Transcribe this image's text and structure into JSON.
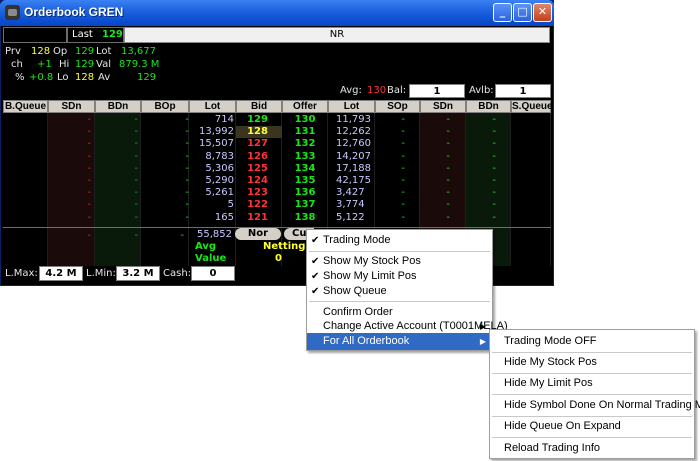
{
  "window": {
    "title": "Orderbook GREN",
    "minimize_glyph": "_",
    "maximize_glyph": "□",
    "close_glyph": "✕"
  },
  "symbol_bar": {
    "last_label": "Last",
    "last_value": "129",
    "status": "NR"
  },
  "stats": {
    "prv_label": "Prv",
    "prv_value": "128",
    "op_label": "Op",
    "op_value": "129",
    "lot_label": "Lot",
    "lot_value": "13,677",
    "ch_label": "ch",
    "ch_value": "+1",
    "hi_label": "Hi",
    "hi_value": "129",
    "val_label": "Val",
    "val_value": "879.3 M",
    "pct_label": "%",
    "pct_value": "+0.8",
    "lo_label": "Lo",
    "lo_value": "128",
    "av_label": "Av",
    "av_value": "129"
  },
  "balances": {
    "avg_label": "Avg:",
    "avg_value": "130",
    "bal_label": "Bal:",
    "bal_value": "1",
    "avlb_label": "Avlb:",
    "avlb_value": "1"
  },
  "table": {
    "headers": [
      "B.Queue",
      "SDn",
      "BDn",
      "BOp",
      "Lot",
      "Bid",
      "Offer",
      "Lot",
      "SOp",
      "SDn",
      "BDn",
      "S.Queue"
    ],
    "rows": [
      {
        "bop": "-",
        "bid_lot": "714",
        "bid": "129",
        "offer": "130",
        "offer_lot": "11,793",
        "sop": "-",
        "sdn": "-",
        "bdn": "-"
      },
      {
        "bop": "-",
        "bid_lot": "13,992",
        "bid": "128",
        "offer": "131",
        "offer_lot": "12,262",
        "sop": "-",
        "sdn": "-",
        "bdn": "-"
      },
      {
        "bop": "-",
        "bid_lot": "15,507",
        "bid": "127",
        "offer": "132",
        "offer_lot": "12,760",
        "sop": "-",
        "sdn": "-",
        "bdn": "-"
      },
      {
        "bop": "-",
        "bid_lot": "8,783",
        "bid": "126",
        "offer": "133",
        "offer_lot": "14,207",
        "sop": "-",
        "sdn": "-",
        "bdn": "-"
      },
      {
        "bop": "-",
        "bid_lot": "5,306",
        "bid": "125",
        "offer": "134",
        "offer_lot": "17,188",
        "sop": "-",
        "sdn": "-",
        "bdn": "-"
      },
      {
        "bop": "-",
        "bid_lot": "5,290",
        "bid": "124",
        "offer": "135",
        "offer_lot": "42,175",
        "sop": "-",
        "sdn": "-",
        "bdn": "-"
      },
      {
        "bop": "-",
        "bid_lot": "5,261",
        "bid": "123",
        "offer": "136",
        "offer_lot": "3,427",
        "sop": "-",
        "sdn": "-",
        "bdn": "-"
      },
      {
        "bop": "-",
        "bid_lot": "5",
        "bid": "122",
        "offer": "137",
        "offer_lot": "3,774",
        "sop": "-",
        "sdn": "-",
        "bdn": "-"
      },
      {
        "bop": "-",
        "bid_lot": "165",
        "bid": "121",
        "offer": "138",
        "offer_lot": "5,122",
        "sop": "-",
        "sdn": "-",
        "bdn": "-"
      }
    ],
    "total_bid_lot": "55,852",
    "nor_button": "Nor",
    "cus_button": "Cus",
    "avg_label": "Avg",
    "value_label": "Value",
    "netting_label": "Netting",
    "netting_value": "0",
    "dash": "-"
  },
  "footer": {
    "lmax_label": "L.Max:",
    "lmax_value": "4.2 M",
    "lmin_label": "L.Min:",
    "lmin_value": "3.2 M",
    "cash_label": "Cash:",
    "cash_value": "0"
  },
  "context_menu": {
    "items": [
      {
        "label": "Trading Mode",
        "checked": true
      },
      {
        "label": "Show My Stock Pos",
        "checked": true
      },
      {
        "label": "Show My Limit Pos",
        "checked": true
      },
      {
        "label": "Show Queue",
        "checked": true
      },
      {
        "label": "Confirm Order"
      },
      {
        "label": "Change Active Account (T0001MELA)"
      },
      {
        "label": "For All Orderbook"
      }
    ],
    "check_glyph": "✔",
    "submenu_arrow": "▶"
  },
  "submenu": {
    "items": [
      "Trading Mode OFF",
      "Hide My Stock Pos",
      "Hide My Limit Pos",
      "Hide Symbol Done On Normal Trading Mode",
      "Hide Queue On Expand",
      "Reload Trading Info"
    ]
  },
  "colors": {
    "background": "#000000",
    "bid_up": "#ffff33",
    "bid_down": "#ff3333",
    "offer": "#19e619",
    "lot": "#c8c8ff",
    "menu_highlight": "#316ac5",
    "titlebar": "#0b4ed1"
  }
}
